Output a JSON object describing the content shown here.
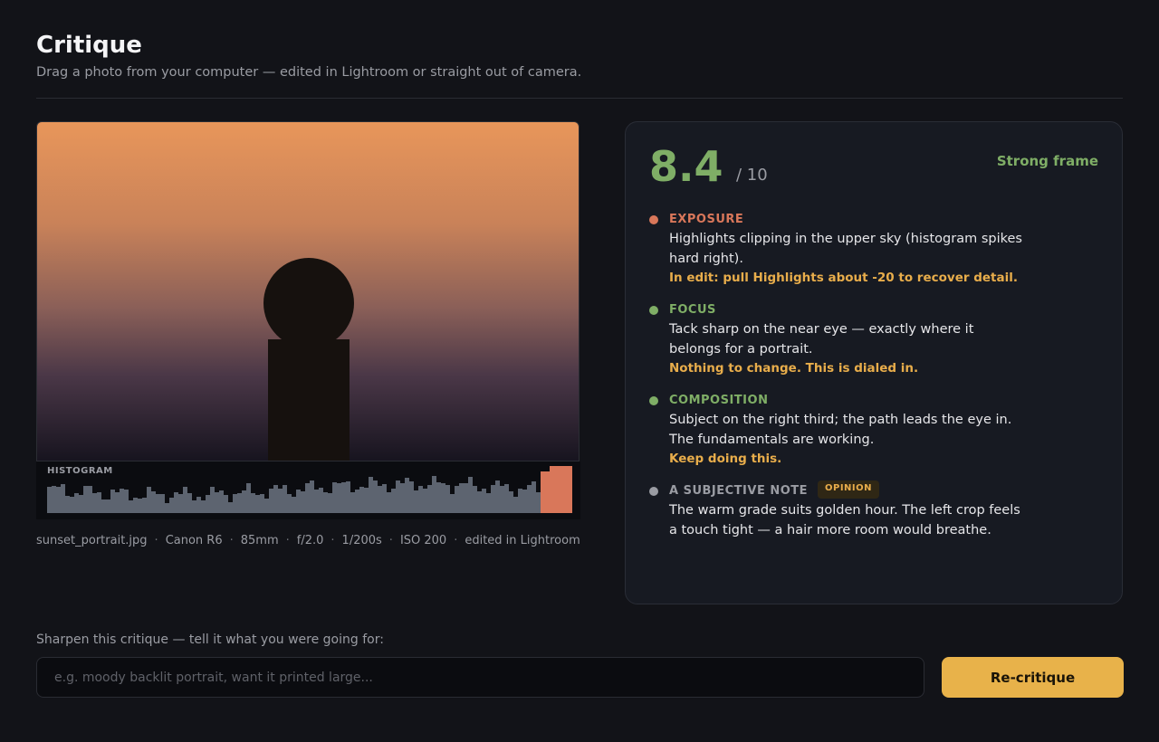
{
  "header": {
    "title": "Critique",
    "subtitle": "Drag a photo from your computer — edited in Lightroom or straight out of camera."
  },
  "photo": {
    "histogram_label": "HISTOGRAM",
    "meta": [
      "sunset_portrait.jpg",
      "Canon R6",
      "85mm",
      "f/2.0",
      "1/200s",
      "ISO 200",
      "edited in Lightroom"
    ]
  },
  "score": {
    "value": "8.4",
    "out_of": "/ 10",
    "verdict": "Strong frame",
    "color": "#7fae66"
  },
  "items": [
    {
      "heading": "EXPOSURE",
      "color": "#d9775a",
      "body": "Highlights clipping in the upper sky (histogram spikes hard right).",
      "tip": "In edit: pull Highlights about -20 to recover detail."
    },
    {
      "heading": "FOCUS",
      "color": "#7fae66",
      "body": "Tack sharp on the near eye — exactly where it belongs for a portrait.",
      "tip": "Nothing to change. This is dialed in."
    },
    {
      "heading": "COMPOSITION",
      "color": "#7fae66",
      "body": "Subject on the right third; the path leads the eye in. The fundamentals are working.",
      "tip": "Keep doing this."
    },
    {
      "heading": "A SUBJECTIVE NOTE",
      "color": "#9a9ca3",
      "badge": "OPINION",
      "body": "The warm grade suits golden hour. The left crop feels a touch tight — a hair more room would breathe."
    }
  ],
  "prompt": {
    "label": "Sharpen this critique — tell it what you were going for:",
    "placeholder": "e.g. moody backlit portrait, want it printed large...",
    "value": "",
    "button_label": "Re-critique",
    "accent": "#e8b24a"
  }
}
